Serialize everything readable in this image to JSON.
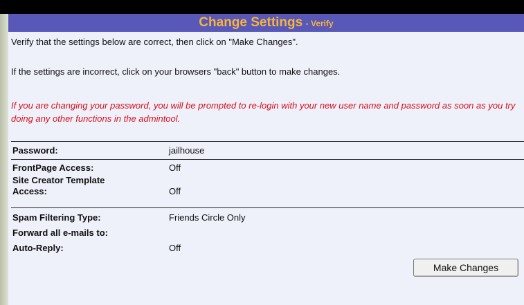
{
  "title": {
    "main": "Change Settings",
    "sub": "- Verify"
  },
  "messages": {
    "verify": "Verify that the settings below are correct, then click on \"Make Changes\".",
    "incorrect": "If the settings are incorrect, click on your browsers \"back\" button to make changes.",
    "warning": "If you are changing your password, you will be prompted to re-login with your new user name and password as soon as you try doing any other functions in the admintool."
  },
  "settings": {
    "password": {
      "label": "Password:",
      "value": "jailhouse"
    },
    "frontpage": {
      "label": "FrontPage Access:",
      "value": "Off"
    },
    "site_creator": {
      "label": "Site Creator Template Access:",
      "value": "Off"
    },
    "spam_filter": {
      "label": "Spam Filtering Type:",
      "value": "Friends Circle Only"
    },
    "forward": {
      "label": "Forward all e-mails to:",
      "value": ""
    },
    "auto_reply": {
      "label": "Auto-Reply:",
      "value": "Off"
    }
  },
  "button": {
    "make_changes": "Make Changes"
  },
  "colors": {
    "title_bg": "#5758b8",
    "title_text": "#f8b33a",
    "warning_text": "#d8111b",
    "panel_bg": "#eef0fa"
  }
}
